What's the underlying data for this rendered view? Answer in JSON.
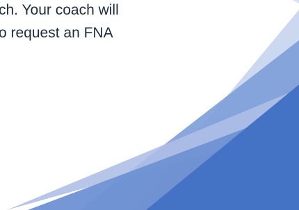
{
  "document": {
    "text_lines": [
      "ch. Your coach will",
      "o request an FNA"
    ]
  },
  "decor": {
    "colors": {
      "pale_blue": "#c9d6ef",
      "mid_blue": "#7f9fd9",
      "deep_blue": "#4472c4"
    }
  }
}
